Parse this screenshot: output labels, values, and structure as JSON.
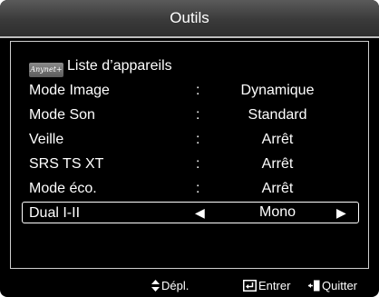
{
  "title": "Outils",
  "anynet": {
    "logo_text": "Anynet+",
    "label": "Liste d’appareils"
  },
  "settings": [
    {
      "label": "Mode Image",
      "sep": ":",
      "value": "Dynamique"
    },
    {
      "label": "Mode Son",
      "sep": ":",
      "value": "Standard"
    },
    {
      "label": "Veille",
      "sep": ":",
      "value": "Arrêt"
    },
    {
      "label": "SRS TS XT",
      "sep": ":",
      "value": "Arrêt"
    },
    {
      "label": "Mode éco.",
      "sep": ":",
      "value": "Arrêt"
    }
  ],
  "selected": {
    "label": "Dual I-II",
    "left_arrow": "◀",
    "value": "Mono",
    "right_arrow": "▶"
  },
  "footer": {
    "move": "Dépl.",
    "enter": "Entrer",
    "exit": "Quitter"
  },
  "icons": {
    "move": "up-down-arrows-icon",
    "enter": "enter-return-icon",
    "exit": "exit-door-icon"
  },
  "colors": {
    "background": "#000000",
    "text": "#ffffff",
    "frame": "#cfcfcf"
  }
}
